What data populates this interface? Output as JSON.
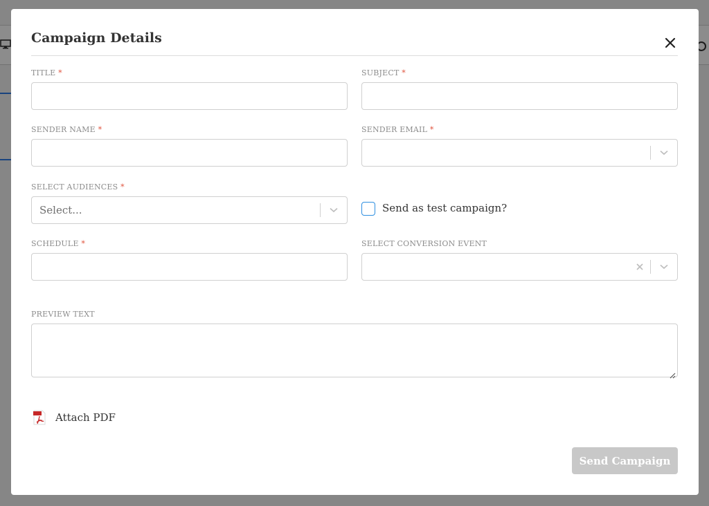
{
  "modal": {
    "title": "Campaign Details",
    "close_icon": "close-icon"
  },
  "form": {
    "title": {
      "label": "TITLE",
      "required_mark": "*",
      "value": ""
    },
    "subject": {
      "label": "SUBJECT",
      "required_mark": "*",
      "value": ""
    },
    "sender_name": {
      "label": "SENDER NAME",
      "required_mark": "*",
      "value": ""
    },
    "sender_email": {
      "label": "SENDER EMAIL",
      "required_mark": "*",
      "value": ""
    },
    "audiences": {
      "label": "SELECT AUDIENCES",
      "required_mark": "*",
      "placeholder": "Select..."
    },
    "test_campaign": {
      "label": "Send as test campaign?",
      "checked": false
    },
    "schedule": {
      "label": "SCHEDULE",
      "required_mark": "*",
      "value": ""
    },
    "conversion_event": {
      "label": "SELECT CONVERSION EVENT",
      "value": ""
    },
    "preview_text": {
      "label": "PREVIEW TEXT",
      "value": ""
    }
  },
  "attach": {
    "label": "Attach PDF",
    "icon": "pdf-icon"
  },
  "actions": {
    "send_label": "Send Campaign"
  },
  "colors": {
    "required": "#e0533d",
    "checkbox_border": "#2c8ee0",
    "button_disabled": "#c8c8c8"
  }
}
